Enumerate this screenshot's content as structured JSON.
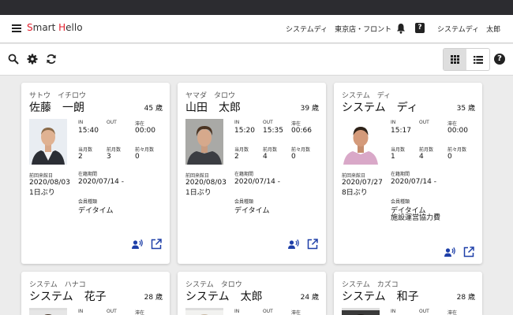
{
  "header": {
    "logo": {
      "s": "S",
      "mart": "mart ",
      "h": "H",
      "ello": "ello"
    },
    "user_org": "システムディ　東京店・フロント",
    "user_name": "システムディ　太郎",
    "help_mark": "?"
  },
  "toolbar": {
    "help_mark": "?",
    "active_view": "grid"
  },
  "labels": {
    "in": "IN",
    "out": "OUT",
    "stay": "滞在",
    "this_month": "当月数",
    "last_month": "前月数",
    "month_before": "前々月数",
    "last_visit": "前回来館日",
    "enrollment": "在籍期間",
    "member_type": "会員種類"
  },
  "cards": [
    {
      "kana": "サトウ　イチロウ",
      "name": "佐藤　一朗",
      "age": "45 歳",
      "in": "15:40",
      "out": "",
      "stay": "00:00",
      "this_month": "2",
      "last_month": "3",
      "month_before": "0",
      "last_visit": "2020/08/03",
      "last_visit_ago": "1日ぶり",
      "enrollment": "2020/07/14 -",
      "member_type": [
        "デイタイム"
      ]
    },
    {
      "kana": "ヤマダ　タロウ",
      "name": "山田　太郎",
      "age": "39 歳",
      "in": "15:20",
      "out": "15:35",
      "stay": "00:66",
      "this_month": "2",
      "last_month": "4",
      "month_before": "0",
      "last_visit": "2020/08/03",
      "last_visit_ago": "1日ぶり",
      "enrollment": "2020/07/14 -",
      "member_type": [
        "デイタイム"
      ]
    },
    {
      "kana": "システム　ディ",
      "name": "システム　ディ",
      "age": "35 歳",
      "in": "15:17",
      "out": "",
      "stay": "00:00",
      "this_month": "1",
      "last_month": "4",
      "month_before": "0",
      "last_visit": "2020/07/27",
      "last_visit_ago": "8日ぶり",
      "enrollment": "2020/07/14 -",
      "member_type": [
        "デイタイム",
        "施設運営協力費"
      ]
    },
    {
      "kana": "システム　ハナコ",
      "name": "システム　花子",
      "age": "28 歳"
    },
    {
      "kana": "システム　タロウ",
      "name": "システム　太郎",
      "age": "24 歳"
    },
    {
      "kana": "システム　カズコ",
      "name": "システム　和子",
      "age": "28 歳"
    }
  ],
  "colors": {
    "accent_blue": "#1e3fa8",
    "logo_red": "#e11d2a",
    "top_strip": "#2c2c30"
  }
}
